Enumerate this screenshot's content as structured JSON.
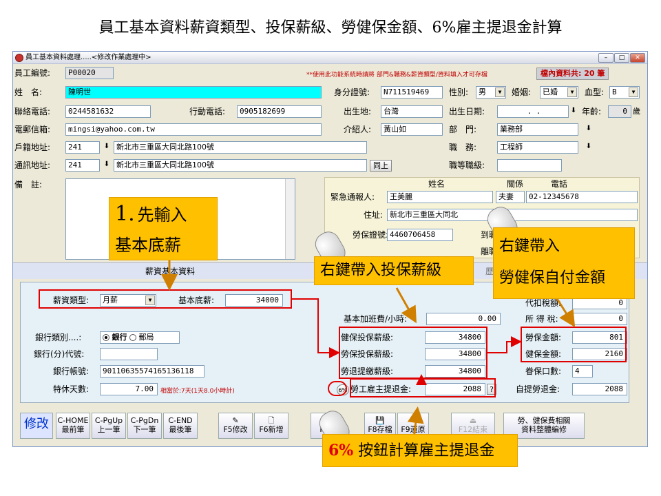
{
  "slide_title": "員工基本資料薪資類型、投保薪級、勞健保金額、6%雇主提退金計算",
  "window": {
    "title": "員工基本資料處理.....<修改作業處理中>",
    "warning": "**使用此功能系統時請將 部門&職務&薪資類型/資料填入才可存檔",
    "record_count": "檔內資料共: 20 筆",
    "min": "–",
    "max": "□",
    "close": "✕"
  },
  "form": {
    "emp_no_label": "員工編號:",
    "emp_no": "P00020",
    "name_label": "姓　名:",
    "name": "陳明世",
    "id_label": "身分證號:",
    "id": "N711519469",
    "gender_label": "性別:",
    "gender": "男",
    "marriage_label": "婚姻:",
    "marriage": "已婚",
    "blood_label": "血型:",
    "blood": "B",
    "phone_label": "聯絡電話:",
    "phone": "0244581632",
    "mobile_label": "行動電話:",
    "mobile": "0905182699",
    "birthplace_label": "出生地:",
    "birthplace": "台灣",
    "birthday_label": "出生日期:",
    "birthday": ". .",
    "age_label": "年齡:",
    "age": "0",
    "age_unit": "歲",
    "email_label": "電郵信箱:",
    "email": "mingsi@yahoo.com.tw",
    "referrer_label": "介紹人:",
    "referrer": "黃山如",
    "dept_label": "部　門:",
    "dept": "業務部",
    "reg_addr_label": "戶籍地址:",
    "reg_zip": "241",
    "reg_addr": "新北市三重區大同北路100號",
    "job_label": "職　務:",
    "job": "工程師",
    "mail_addr_label": "通訊地址:",
    "mail_zip": "241",
    "mail_addr": "新北市三重區大同北路100號",
    "same_btn": "同上",
    "grade_label": "職等職級:",
    "memo_label": "備　註:"
  },
  "contact": {
    "col_name": "姓名",
    "col_rel": "關係",
    "col_phone": "電話",
    "label": "緊急通報人:",
    "name": "王美麗",
    "rel": "夫妻",
    "phone": "02-12345678",
    "addr_label": "住址:",
    "addr": "新北市三重區大同北",
    "ins_no_label": "勞保證號:",
    "ins_no": "4460706458",
    "join_label": "到職日",
    "leave_label": "離職日"
  },
  "tabs": {
    "salary": "薪資基本資料",
    "other": "歷與"
  },
  "salary": {
    "type_label": "薪資類型:",
    "type": "月薪",
    "base_label": "基本底薪:",
    "base": "34000",
    "ot_label": "基本加班費/小時:",
    "ot": "0.00",
    "health_grade_label": "健保投保薪級:",
    "health_grade": "34800",
    "labor_grade_label": "勞保投保薪級:",
    "labor_grade": "34800",
    "pension_grade_label": "勞退提繳薪級:",
    "pension_grade": "34800",
    "employer_pension_label": "勞工雇主提退金:",
    "employer_pension": "2088",
    "help_btn": "?",
    "pct_btn": "6%",
    "bank_type_label": "銀行類別....:",
    "bank": "銀行",
    "post": "郵局",
    "bank_code_label": "銀行(分)代號:",
    "bank_code": "",
    "account_label": "銀行帳號:",
    "account": "90110635574165136118",
    "leave_label": "特休天數:",
    "leave_days": "7.00",
    "leave_note": "相當於:7天(1天8.0小時計)",
    "withhold_label": "代扣稅額:",
    "withhold": "0",
    "tax_label": "所 得 稅:",
    "tax": "0",
    "labor_fee_label": "勞保金額:",
    "labor_fee": "801",
    "health_fee_label": "健保金額:",
    "health_fee": "2160",
    "dependents_label": "眷保口數:",
    "dependents": "4",
    "self_pension_label": "自提勞退金:",
    "self_pension": "2088"
  },
  "toolbar": {
    "mode": "修改",
    "home": "C-HOME",
    "home_sub": "最前筆",
    "pgup": "C-PgUp",
    "pgup_sub": "上一筆",
    "pgdn": "C-PgDn",
    "pgdn_sub": "下一筆",
    "end": "C-END",
    "end_sub": "最後筆",
    "f5": "F5修改",
    "f6": "F6新增",
    "f7": "F7",
    "f8": "F8存檔",
    "f9": "F9還原",
    "f12": "F12結束",
    "batch": "勞、健保費相關",
    "batch2": "資料整體編修"
  },
  "callouts": {
    "c1_num": "1.",
    "c1_line1": "先輸入",
    "c1_line2": "基本底薪",
    "c2": "右鍵帶入投保薪級",
    "c3_line1": "右鍵帶入",
    "c3_line2": "勞健保自付金額",
    "c4_pct": "6%",
    "c4_text": "按鈕計算雇主提退金"
  },
  "colors": {
    "callout": "#ffc000",
    "annot_red": "#e00000",
    "highlight": "#00ffff"
  }
}
